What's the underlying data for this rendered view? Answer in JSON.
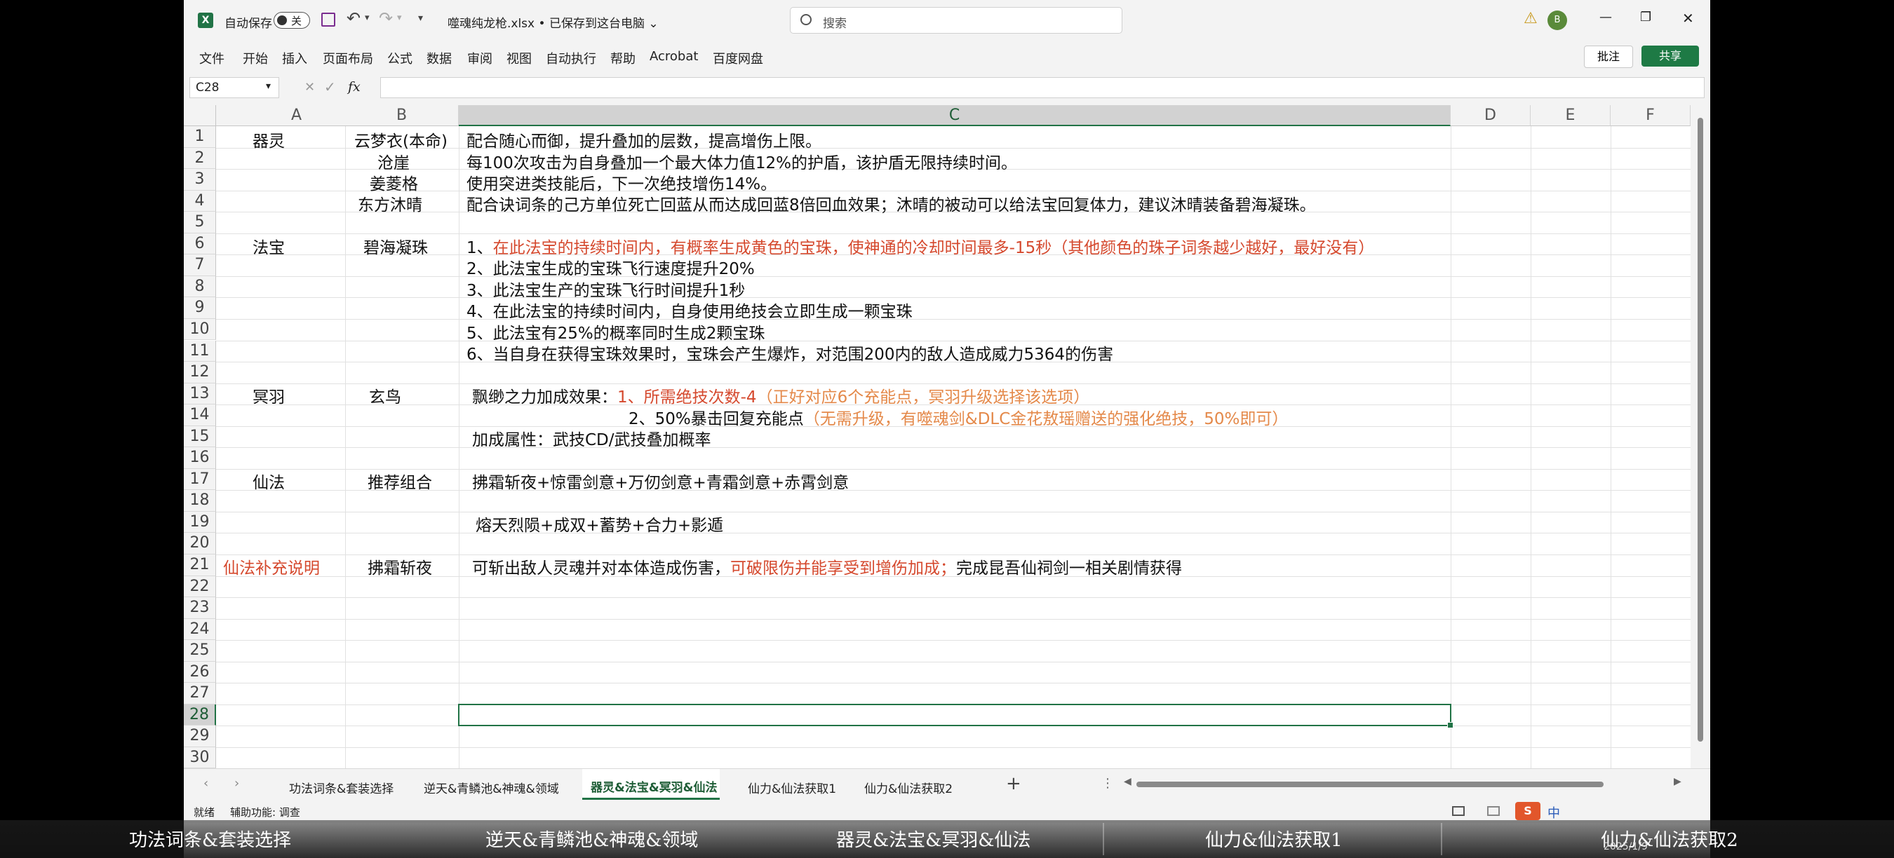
{
  "titlebar": {
    "autosave_label": "自动保存",
    "autosave_state": "关",
    "more_arrow": "▾",
    "filename": "噬魂纯龙枪.xlsx • 已保存到这台电脑 ⌄",
    "search_placeholder": "搜索",
    "avatar_initial": "B",
    "warning": "⚠",
    "min": "—",
    "restore": "❐",
    "close": "✕",
    "undo": "↶",
    "redo": "↷"
  },
  "ribbon": {
    "items": [
      "文件",
      "开始",
      "插入",
      "页面布局",
      "公式",
      "数据",
      "审阅",
      "视图",
      "自动执行",
      "帮助",
      "Acrobat",
      "百度网盘"
    ],
    "comment_label": "批注",
    "share_label": "共享"
  },
  "formula_bar": {
    "cell_ref": "C28",
    "fx": "fx",
    "value": ""
  },
  "grid": {
    "columns": [
      "A",
      "B",
      "C",
      "D",
      "E",
      "F"
    ],
    "rows": [
      "1",
      "2",
      "3",
      "4",
      "5",
      "6",
      "7",
      "8",
      "9",
      "10",
      "11",
      "12",
      "13",
      "14",
      "15",
      "16",
      "17",
      "18",
      "19",
      "20",
      "21",
      "22",
      "23",
      "24",
      "25",
      "26",
      "27",
      "28",
      "29",
      "30"
    ],
    "cells": {
      "a1": "器灵",
      "b1": "云梦衣(本命)",
      "c1": "配合随心而御，提升叠加的层数，提高增伤上限。",
      "b2": "沧崖",
      "c2": "每100次攻击为自身叠加一个最大体力值12%的护盾，该护盾无限持续时间。",
      "b3": "姜菱格",
      "c3": "使用突进类技能后，下一次绝技增伤14%。",
      "b4": "东方沐晴",
      "c4": "配合诀词条的己方单位死亡回蓝从而达成回蓝8倍回血效果；沐晴的被动可以给法宝回复体力，建议沐晴装备碧海凝珠。",
      "a6": "法宝",
      "b6": "碧海凝珠",
      "c6_prefix": "1、",
      "c6_red": "在此法宝的持续时间内，有概率生成黄色的宝珠，使神通的冷却时间最多-15秒（其他颜色的珠子词条越少越好，最好没有）",
      "c7": "2、此法宝生成的宝珠飞行速度提升20%",
      "c8": "3、此法宝生产的宝珠飞行时间提升1秒",
      "c9": "4、在此法宝的持续时间内，自身使用绝技会立即生成一颗宝珠",
      "c10": "5、此法宝有25%的概率同时生成2颗宝珠",
      "c11": "6、当自身在获得宝珠效果时，宝珠会产生爆炸，对范围200内的敌人造成威力5364的伤害",
      "a13": "冥羽",
      "b13": "玄鸟",
      "c13_prefix": "飘缈之力加成效果：",
      "c13_red": "1、所需绝技次数-4",
      "c13_orange": "（正好对应6个充能点，冥羽升级选择该选项）",
      "c14_prefix": "2、50%暴击回复充能点",
      "c14_orange": "（无需升级，有噬魂剑&DLC金花敖瑶赠送的强化绝技，50%即可）",
      "c15": "加成属性：武技CD/武技叠加概率",
      "a17": "仙法",
      "b17": "推荐组合",
      "c17": "拂霜斩夜+惊雷剑意+万仞剑意+青霜剑意+赤霄剑意",
      "c19": "熔天烈陨+成双+蓄势+合力+影遁",
      "a21": "仙法补充说明",
      "b21": "拂霜斩夜",
      "c21_prefix": "可斩出敌人灵魂并对本体造成伤害，",
      "c21_red": "可破限伤并能享受到增伤加成；",
      "c21_suffix": "完成昆吾仙祠剑一相关剧情获得"
    }
  },
  "sheet_tabs": [
    "功法词条&套装选择",
    "逆天&青鳞池&神魂&领域",
    "器灵&法宝&冥羽&仙法",
    "仙力&仙法获取1",
    "仙力&仙法获取2"
  ],
  "active_tab": "器灵&法宝&冥羽&仙法",
  "add_sheet": "+",
  "status": {
    "ready": "就绪",
    "accessibility": "辅助功能: 调查"
  },
  "overlay_captions": [
    "功法词条&套装选择",
    "逆天&青鳞池&神魂&领域",
    "器灵&法宝&冥羽&仙法",
    "仙力&仙法获取1",
    "仙力&仙法获取2"
  ],
  "taskbar": {
    "ime": "中",
    "date": "2025/1/9"
  },
  "colors": {
    "excel_green": "#217346",
    "share_green": "#1e7a45",
    "red_text": "#d5492e",
    "orange_text": "#e4894a"
  }
}
